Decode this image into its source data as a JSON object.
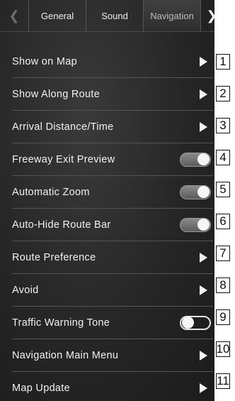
{
  "tabbar": {
    "prev_icon": "chevron-left-icon",
    "next_icon": "chevron-right-icon",
    "tabs": [
      {
        "label": "General"
      },
      {
        "label": "Sound"
      },
      {
        "label": "Navigation"
      }
    ],
    "active_tab": "Navigation"
  },
  "settings": {
    "items": [
      {
        "label": "Show on Map",
        "control": "arrow",
        "callout": "1"
      },
      {
        "label": "Show Along Route",
        "control": "arrow",
        "callout": "2"
      },
      {
        "label": "Arrival Distance/Time",
        "control": "arrow",
        "callout": "3"
      },
      {
        "label": "Freeway Exit Preview",
        "control": "toggle",
        "state": "on",
        "callout": "4"
      },
      {
        "label": "Automatic Zoom",
        "control": "toggle",
        "state": "on",
        "callout": "5"
      },
      {
        "label": "Auto-Hide Route Bar",
        "control": "toggle",
        "state": "on",
        "callout": "6"
      },
      {
        "label": "Route Preference",
        "control": "arrow",
        "callout": "7"
      },
      {
        "label": "Avoid",
        "control": "arrow",
        "callout": "8"
      },
      {
        "label": "Traffic Warning Tone",
        "control": "toggle",
        "state": "off",
        "callout": "9"
      },
      {
        "label": "Navigation Main Menu",
        "control": "arrow",
        "callout": "10"
      },
      {
        "label": "Map Update",
        "control": "arrow",
        "callout": "11"
      }
    ]
  },
  "colors": {
    "background": "#262626",
    "text": "#f2f2f2",
    "divider": "#555555",
    "toggle_on": "#8a8a8a"
  }
}
